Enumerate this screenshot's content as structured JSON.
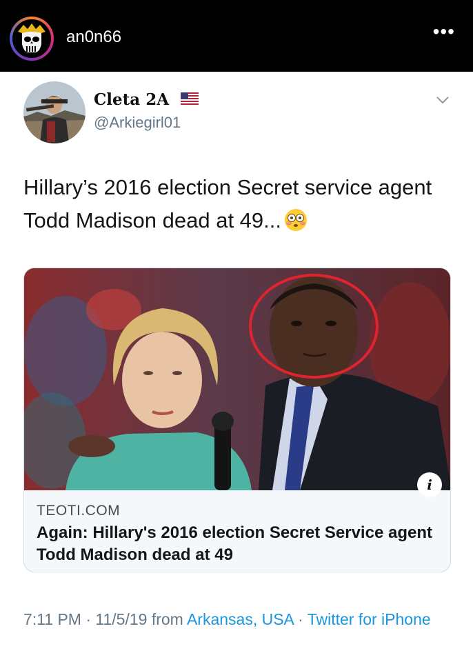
{
  "instagram": {
    "username": "an0n66",
    "more_icon": "more-horizontal-icon"
  },
  "tweet": {
    "display_name": "Cleta 2A",
    "handle": "@Arkiegirl01",
    "text": "Hillary’s 2016 election Secret service agent Todd Madison dead at 49...",
    "emoji_name": "flushed-face-emoji",
    "card": {
      "domain": "TEOTI.COM",
      "title": "Again: Hillary's 2016 election Secret Service agent Todd Madison dead at 49"
    },
    "time": "7:11 PM",
    "date": "11/5/19",
    "from_label": "from",
    "location": "Arkansas, USA",
    "source": "Twitter for iPhone",
    "separator": "·"
  },
  "colors": {
    "link": "#1b95e0",
    "handle": "#657786",
    "header_bg": "#000000",
    "highlight_circle": "#e0242f"
  }
}
